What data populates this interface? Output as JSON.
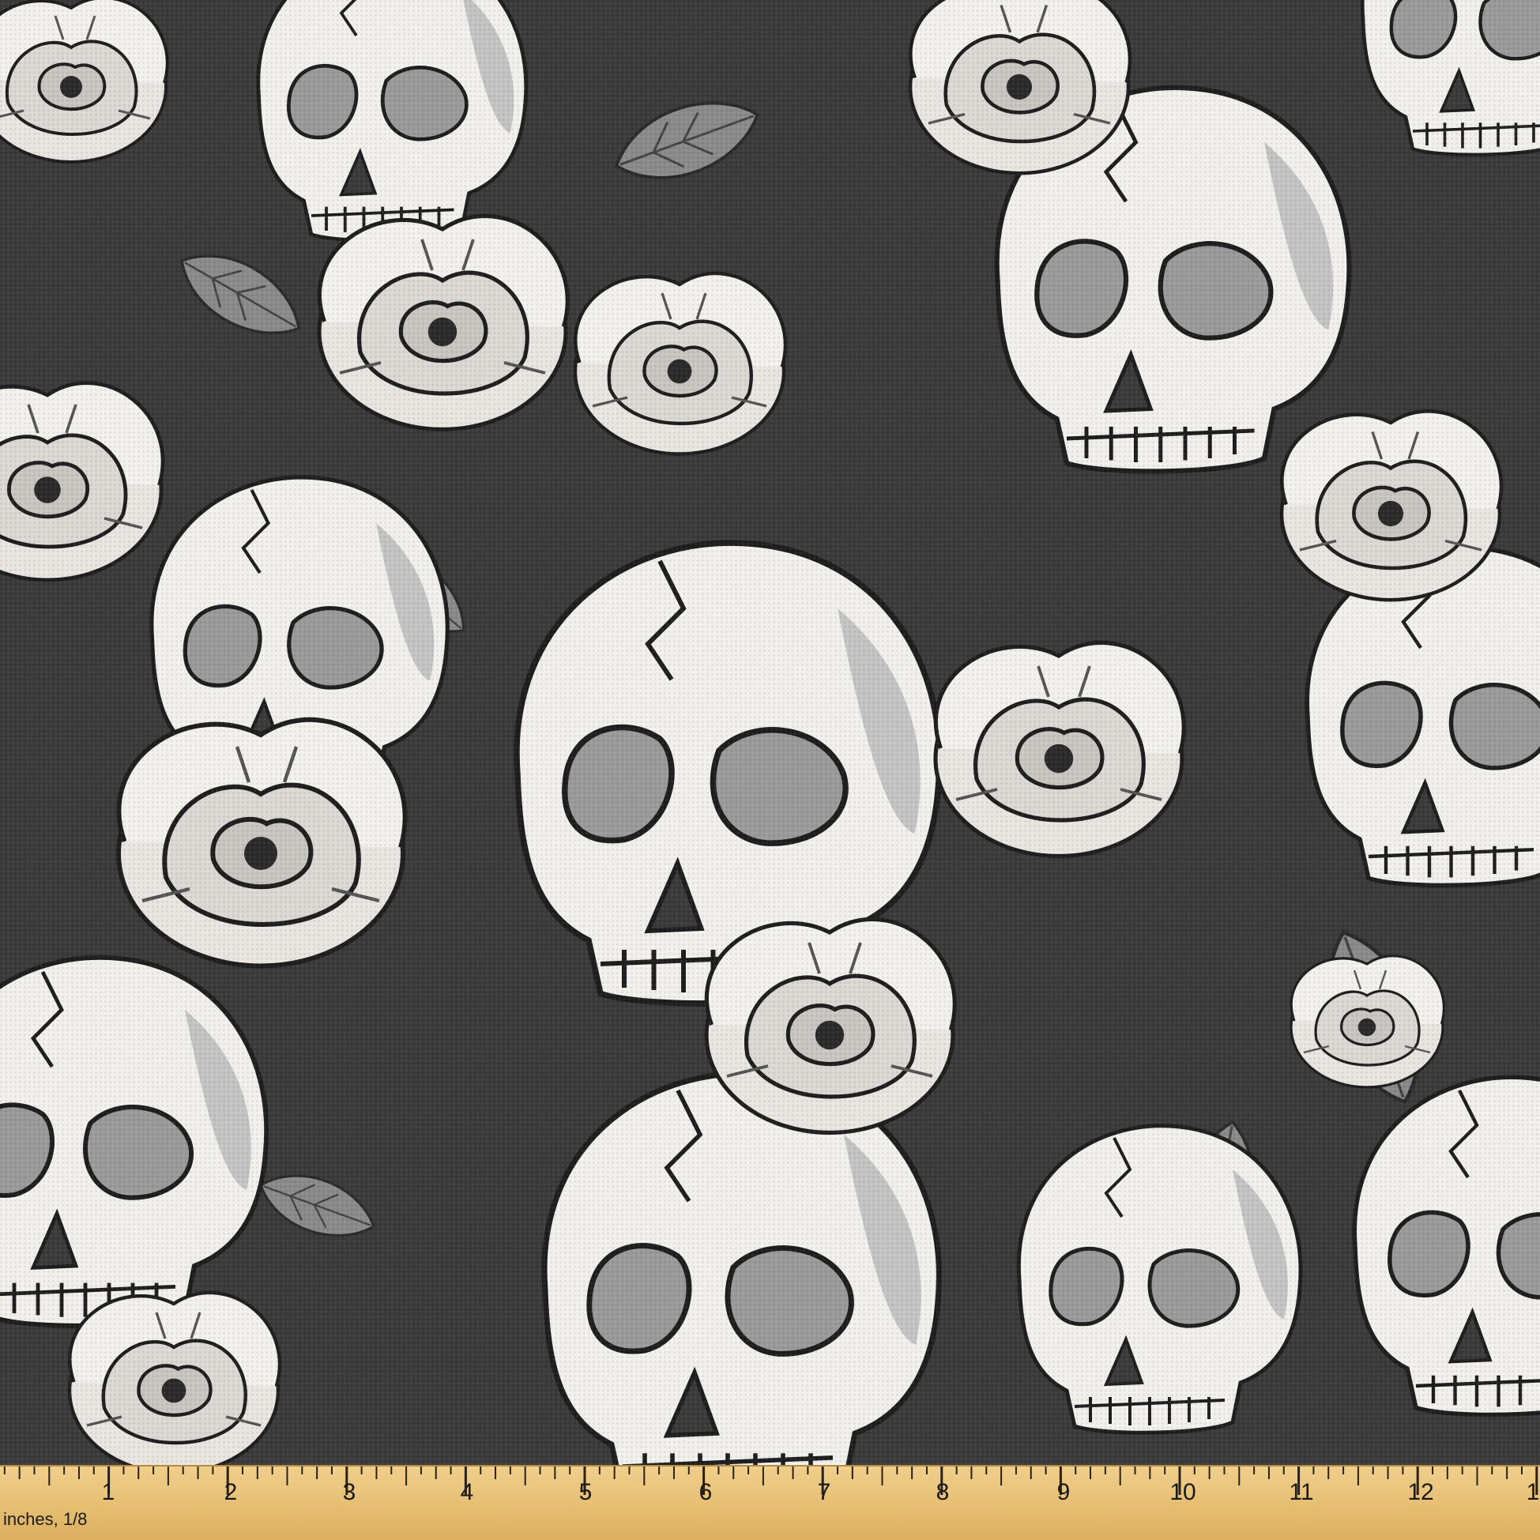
{
  "image": {
    "subject": "skulls-and-roses-fabric",
    "background_color": "#3a3a3a",
    "skull_color": "#f2f0ec",
    "skull_shade": "#bdbdbd",
    "petal_color": "#ece9e4",
    "leaf_color": "#8a8a8a",
    "ink_color": "#1e1e1e"
  },
  "ruler": {
    "unit_label": "inches, 1/8",
    "numbers": [
      "1",
      "2",
      "3",
      "4",
      "5",
      "6",
      "7",
      "8",
      "9",
      "10",
      "11",
      "12",
      "1"
    ],
    "color": "#e8c47e"
  }
}
